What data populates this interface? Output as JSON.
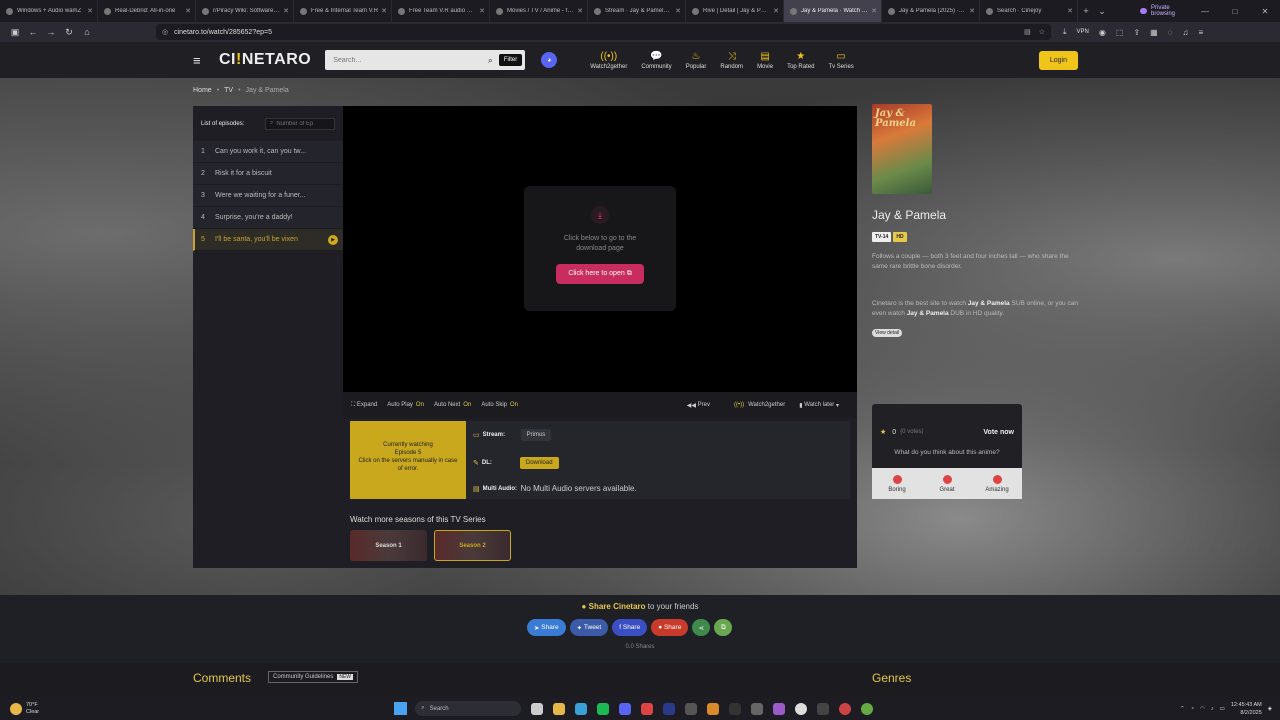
{
  "browser": {
    "tabs": [
      {
        "title": "Windows + Audio wamZ",
        "active": false
      },
      {
        "title": "Real-Debrid: All-in-one",
        "active": false
      },
      {
        "title": "r/Piracy Wiki: Software Do...",
        "active": false
      },
      {
        "title": "Free & Internal Team V.R",
        "active": false
      },
      {
        "title": "Free Team V.R audio mixe",
        "active": false
      },
      {
        "title": "Movies / TV / Anime - free",
        "active": false
      },
      {
        "title": "Stream · Jay & Pamela · Ci",
        "active": false
      },
      {
        "title": "Rive | Detail | Jay & Pamela",
        "active": false
      },
      {
        "title": "Jay & Pamela · Watch On",
        "active": true
      },
      {
        "title": "Jay & Pamela (2025) · Wa",
        "active": false
      },
      {
        "title": "Search · Cinejoy",
        "active": false
      }
    ],
    "private_label": "Private browsing",
    "url": "cinetaro.to/watch/285652?ep=5",
    "vpn_label": "VPN"
  },
  "site": {
    "logo_main": "CI",
    "logo_bang": "!",
    "logo_rest": "NETARO",
    "search_placeholder": "Search...",
    "filter_label": "Filter",
    "nav": [
      {
        "label": "Watch2gether",
        "icon": "broadcast-icon",
        "glyph": "((•))"
      },
      {
        "label": "Community",
        "icon": "chat-icon",
        "glyph": "💬"
      },
      {
        "label": "Popular",
        "icon": "flame-icon",
        "glyph": "♨"
      },
      {
        "label": "Random",
        "icon": "shuffle-icon",
        "glyph": "⤨"
      },
      {
        "label": "Movie",
        "icon": "film-icon",
        "glyph": "▤"
      },
      {
        "label": "Top Rated",
        "icon": "star-icon",
        "glyph": "★"
      },
      {
        "label": "Tv Series",
        "icon": "tv-icon",
        "glyph": "▭"
      }
    ],
    "login_label": "Login"
  },
  "breadcrumb": {
    "home": "Home",
    "section": "TV",
    "current": "Jay & Pamela"
  },
  "episodes": {
    "header": "List of episodes:",
    "search_placeholder": "Number of Ep",
    "items": [
      {
        "num": "1",
        "title": "Can you work it, can you tw..."
      },
      {
        "num": "2",
        "title": "Risk it for a biscuit"
      },
      {
        "num": "3",
        "title": "Were we waiting for a funer..."
      },
      {
        "num": "4",
        "title": "Surprise, you're a daddy!"
      },
      {
        "num": "5",
        "title": "I'll be santa, you'll be vixen"
      }
    ]
  },
  "player": {
    "download_text": "Click below to go to the download page",
    "open_label": "Click here to open"
  },
  "controls": {
    "expand": "Expand",
    "autoplay": "Auto Play",
    "autonext": "Auto Next",
    "autoskip": "Auto Skip",
    "on": "On",
    "prev": "Prev",
    "watch2gether": "Watch2gether",
    "watch_later": "Watch later"
  },
  "current": {
    "line1": "Currently watching",
    "line2": "Episode 5",
    "line3": "Click on the servers manually in case of error."
  },
  "servers": {
    "stream_label": "Stream:",
    "stream_server": "Primus",
    "dl_label": "DL:",
    "dl_server": "Download",
    "multi_label": "Multi Audio:",
    "multi_msg": "No Multi Audio servers available."
  },
  "seasons": {
    "title": "Watch more seasons of this TV Series",
    "items": [
      "Season 1",
      "Season 2"
    ]
  },
  "show": {
    "poster_text": "Jay & Pamela",
    "title": "Jay & Pamela",
    "rating_badge": "TV-14",
    "quality_badge": "HD",
    "description": "Follows a couple — both 3 feet and four inches tall — who share the same rare brittle bone disorder.",
    "promo_pre": "Cinetaro is the best site to watch ",
    "promo_title1": "Jay & Pamela",
    "promo_mid": " SUB online, or you can even watch ",
    "promo_title2": "Jay & Pamela",
    "promo_post": " DUB in HD quality.",
    "view_detail": "View detail"
  },
  "vote": {
    "score": "0",
    "votes": "(0 votes)",
    "vote_now": "Vote now",
    "question": "What do you think about this anime?",
    "reactions": [
      "Boring",
      "Great",
      "Amazing"
    ]
  },
  "share": {
    "title_bold": "Share Cinetaro",
    "title_rest": " to your friends",
    "buttons": [
      "Share",
      "Tweet",
      "Share",
      "Share"
    ],
    "count": "0.0",
    "count_label": "Shares"
  },
  "comments": {
    "title": "Comments",
    "guidelines": "Community Guidelines",
    "new_badge": "NEW",
    "genres": "Genres"
  },
  "taskbar": {
    "temp": "70°F",
    "condition": "Clear",
    "search": "Search",
    "time": "12:45:43 AM",
    "date": "8/2/2025"
  },
  "colors": {
    "accent": "#f0c419",
    "open_button": "#c92d5f"
  }
}
